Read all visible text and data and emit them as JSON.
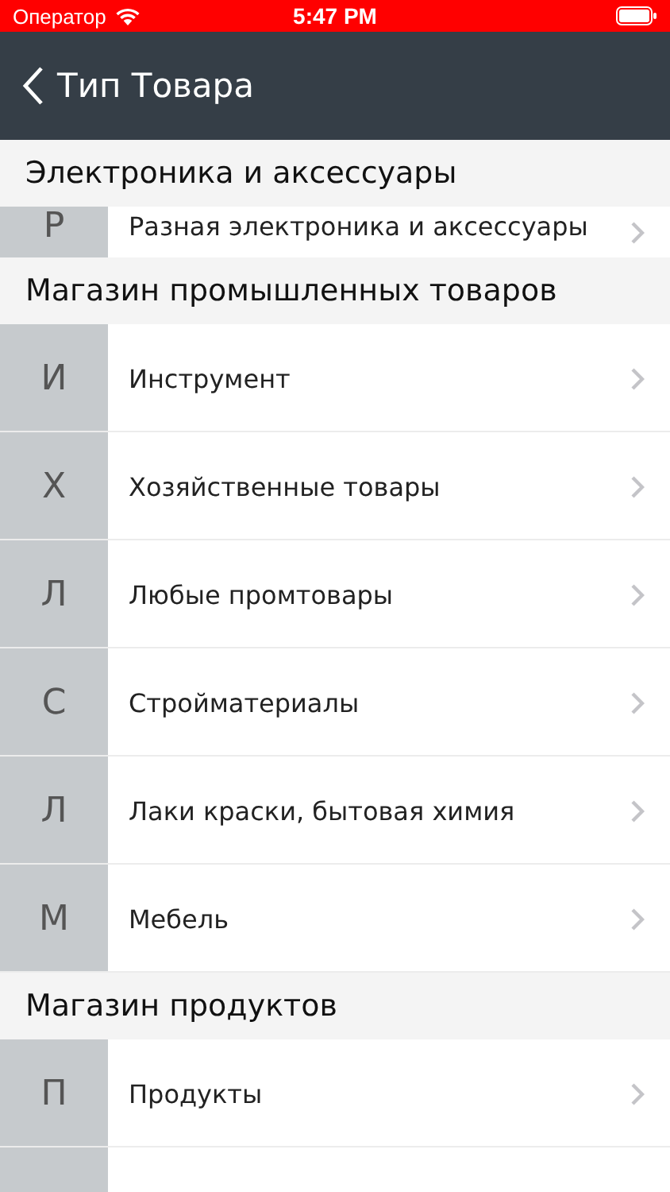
{
  "status_bar": {
    "carrier": "Оператор",
    "time": "5:47 PM"
  },
  "nav": {
    "title": "Тип Товара"
  },
  "sections": [
    {
      "title": "Электроника и аксессуары",
      "rows": [
        {
          "letter": "Р",
          "name": "Разная электроника и аксессуары",
          "kind": "partial"
        }
      ]
    },
    {
      "title": "Магазин промышленных товаров",
      "rows": [
        {
          "letter": "И",
          "name": "Инструмент",
          "kind": "full"
        },
        {
          "letter": "Х",
          "name": "Хозяйственные товары",
          "kind": "full"
        },
        {
          "letter": "Л",
          "name": "Любые промтовары",
          "kind": "full"
        },
        {
          "letter": "С",
          "name": "Стройматериалы",
          "kind": "full"
        },
        {
          "letter": "Л",
          "name": "Лаки краски, бытовая химия",
          "kind": "full"
        },
        {
          "letter": "М",
          "name": "Мебель",
          "kind": "full"
        }
      ]
    },
    {
      "title": "Магазин продуктов",
      "rows": [
        {
          "letter": "П",
          "name": "Продукты",
          "kind": "full"
        },
        {
          "kind": "cut"
        }
      ]
    }
  ]
}
